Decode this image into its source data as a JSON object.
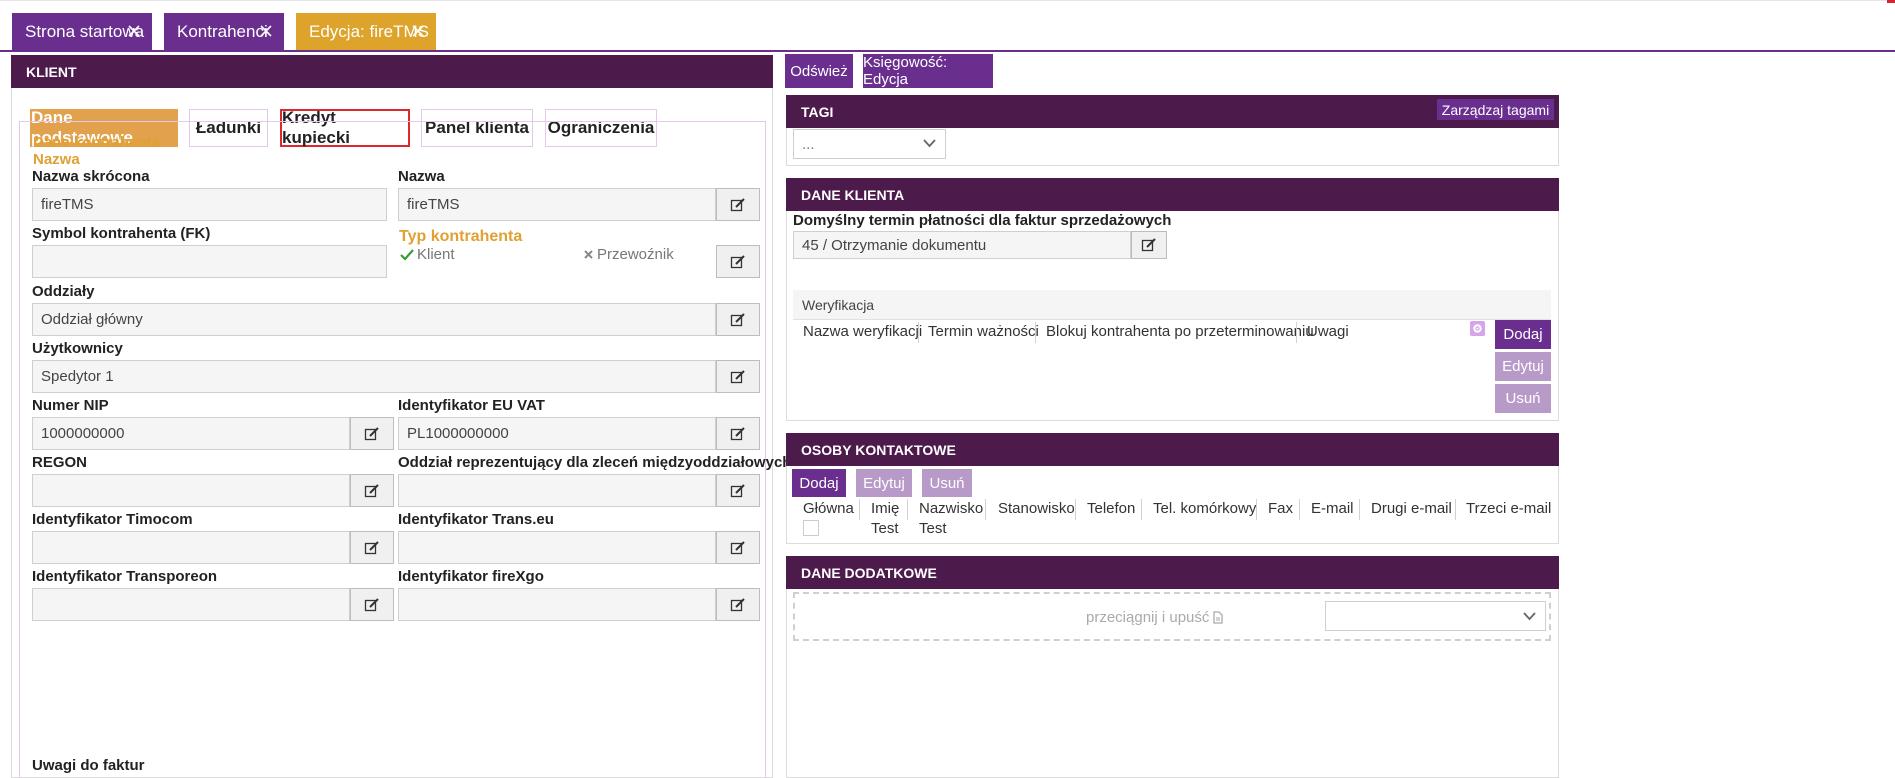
{
  "top_tabs": [
    {
      "label": "Strona startowa"
    },
    {
      "label": "Kontrahenci"
    },
    {
      "label": "Edycja: fireTMS"
    }
  ],
  "left_panel": {
    "title": "KLIENT",
    "tabs": [
      "Dane podstawowe",
      "Ładunki",
      "Kredyt kupiecki",
      "Panel klienta",
      "Ograniczenia"
    ],
    "section_title": "Dane kontrahenta",
    "section_sub": "Nazwa",
    "fields": {
      "short_name": {
        "label": "Nazwa skrócona",
        "value": "fireTMS"
      },
      "name": {
        "label": "Nazwa",
        "value": "fireTMS"
      },
      "symbol": {
        "label": "Symbol kontrahenta (FK)",
        "value": ""
      },
      "type": {
        "label": "Typ kontrahenta",
        "klient": "Klient",
        "przewoznik": "Przewoźnik"
      },
      "branches": {
        "label": "Oddziały",
        "value": "Oddział główny"
      },
      "users": {
        "label": "Użytkownicy",
        "value": "Spedytor 1"
      },
      "nip": {
        "label": "Numer NIP",
        "value": "1000000000"
      },
      "eu_vat": {
        "label": "Identyfikator EU VAT",
        "value": "PL1000000000"
      },
      "regon": {
        "label": "REGON",
        "value": ""
      },
      "rep_branch": {
        "label": "Oddział reprezentujący dla zleceń międzyoddziałowych",
        "value": ""
      },
      "timocom": {
        "label": "Identyfikator Timocom",
        "value": ""
      },
      "transeu": {
        "label": "Identyfikator Trans.eu",
        "value": ""
      },
      "transporeon": {
        "label": "Identyfikator Transporeon",
        "value": ""
      },
      "firexgo": {
        "label": "Identyfikator fireXgo",
        "value": ""
      },
      "invoice_notes": {
        "label": "Uwagi do faktur"
      }
    }
  },
  "right": {
    "refresh_label": "Odśwież",
    "accounting_label": "Księgowość: Edycja",
    "tags": {
      "title": "TAGI",
      "manage_label": "Zarządzaj tagami",
      "select_value": "..."
    },
    "client_data": {
      "title": "DANE KLIENTA",
      "payment_label": "Domyślny termin płatności dla faktur sprzedażowych",
      "payment_value": "45 / Otrzymanie dokumentu",
      "verification_title": "Weryfikacja",
      "columns": [
        "Nazwa weryfikacji",
        "Termin ważności",
        "Blokuj kontrahenta po przeterminowaniu",
        "Uwagi"
      ],
      "add_label": "Dodaj",
      "edit_label": "Edytuj",
      "delete_label": "Usuń"
    },
    "contacts": {
      "title": "OSOBY KONTAKTOWE",
      "add_label": "Dodaj",
      "edit_label": "Edytuj",
      "delete_label": "Usuń",
      "columns": [
        "Główna",
        "Imię",
        "Nazwisko",
        "Stanowisko",
        "Telefon",
        "Tel. komórkowy",
        "Fax",
        "E-mail",
        "Drugi e-mail",
        "Trzeci e-mail"
      ],
      "rows": [
        {
          "first_name": "Test",
          "last_name": "Test"
        }
      ]
    },
    "extra": {
      "title": "DANE DODATKOWE",
      "dropzone_label": "przeciągnij i upuść"
    }
  },
  "colors": {
    "purple": "#6a2f8e",
    "dark_header": "#4d1a4c",
    "orange": "#dea32a",
    "highlight": "#e0262e"
  }
}
